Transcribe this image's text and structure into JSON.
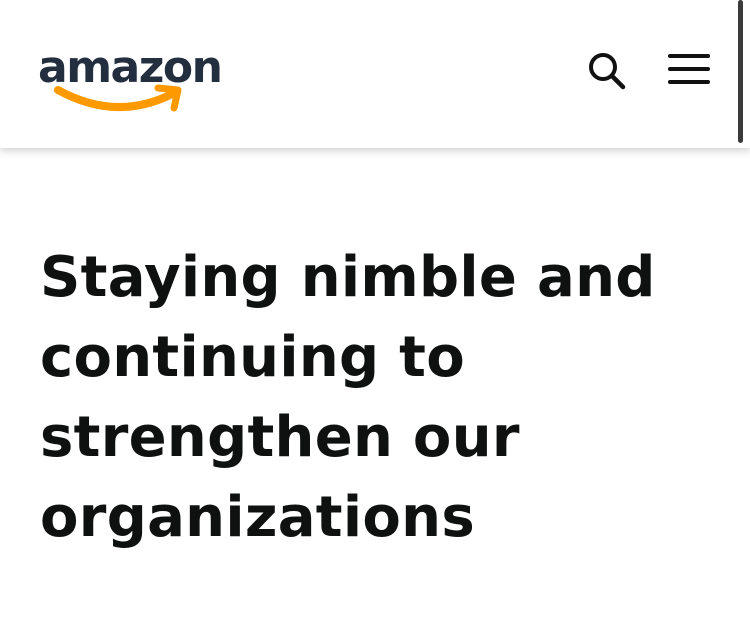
{
  "header": {
    "logo_text": "amazon",
    "logo_text_color": "#232f3e",
    "logo_smile_color": "#ff9900",
    "search_icon": "search-icon",
    "menu_icon": "hamburger-menu-icon"
  },
  "article": {
    "headline": "Staying nimble and continuing to strengthen our organizations"
  }
}
